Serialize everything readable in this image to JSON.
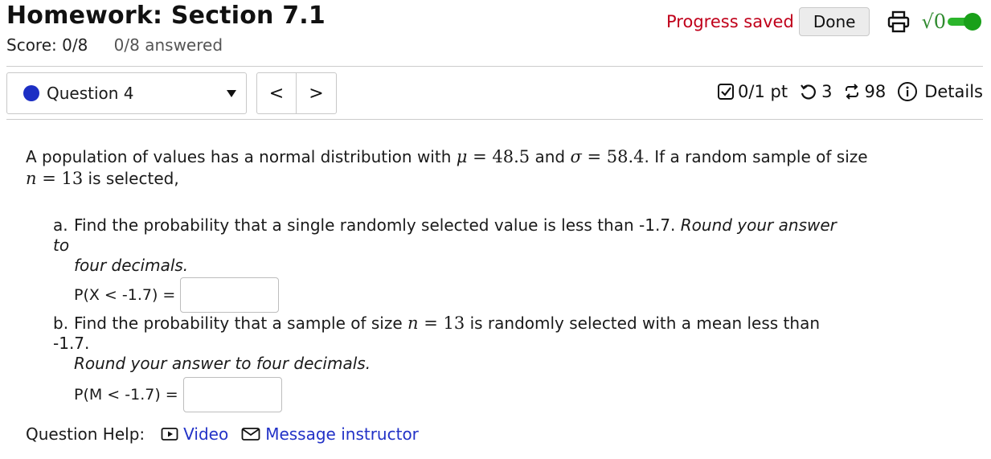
{
  "header": {
    "title": "Homework: Section 7.1",
    "score": "Score: 0/8",
    "answered": "0/8 answered",
    "progress_saved": "Progress saved",
    "done_label": "Done",
    "sqrt_symbol": "√0"
  },
  "question_nav": {
    "selected_question": "Question 4",
    "prev_label": "<",
    "next_label": ">"
  },
  "meta": {
    "points": "0/1 pt",
    "retries": "3",
    "attempts": "98",
    "details_label": "Details"
  },
  "problem": {
    "intro_1": "A population of values has a normal distribution with ",
    "mu": "μ",
    "mu_value": " = 48.5",
    "and": " and ",
    "sigma": "σ",
    "sigma_value": " = 58.4",
    "intro_2": ". If a random sample of size",
    "n": "n",
    "n_value": " = 13",
    "intro_3": " is selected,"
  },
  "part_a": {
    "label": "a.",
    "text": "Find the probability that a single randomly selected value is less than -1.7. ",
    "italic_1": "Round your answer to",
    "italic_2": "four decimals.",
    "prob_label": "P(X < -1.7) =",
    "answer_value": ""
  },
  "part_b": {
    "label": "b.",
    "text_1": "Find the probability that a sample of size ",
    "n": "n",
    "n_value": " = 13",
    "text_2": " is randomly selected with a mean less than -1.7.",
    "italic": "Round your answer to four decimals.",
    "prob_label": "P(M < -1.7) =",
    "answer_value": ""
  },
  "help": {
    "label": "Question Help:",
    "video_label": "Video",
    "message_label": "Message instructor"
  },
  "colors": {
    "progress_saved": "#c0001a",
    "question_dot": "#1c2fc4",
    "toggle_on": "#2bb52b",
    "link": "#2232c7"
  }
}
